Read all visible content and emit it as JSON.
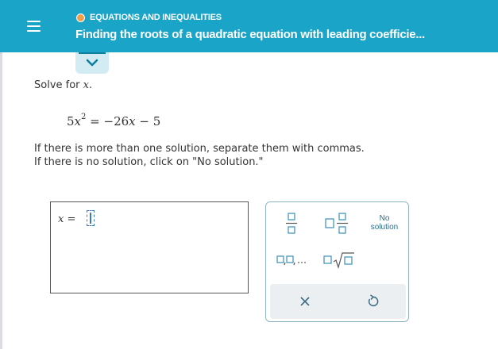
{
  "header": {
    "topic": "EQUATIONS AND INEQUALITIES",
    "title": "Finding the roots of a quadratic equation with leading coefficie..."
  },
  "problem": {
    "prompt_prefix": "Solve for",
    "prompt_var": "x",
    "prompt_suffix": ".",
    "equation": {
      "coef": "5",
      "var": "x",
      "exponent": "2",
      "rhs_eq": " = −26",
      "rhs_var": "x",
      "rhs_tail": " − 5"
    },
    "instruction_1": "If there is more than one solution, separate them with commas.",
    "instruction_2": "If there is no solution, click on \"No solution.\""
  },
  "answer": {
    "label_var": "x",
    "label_eq": " = ",
    "value": ""
  },
  "keypad": {
    "no_solution_line1": "No",
    "no_solution_line2": "solution",
    "keys": [
      "fraction-key",
      "mixed-number-key",
      "comma-list-key",
      "square-root-key",
      "clear-key",
      "undo-key"
    ]
  },
  "colors": {
    "header_bg": "#1aa4c8",
    "topic_dot": "#f0a04b",
    "keypad_blue": "#3a8fb7"
  }
}
